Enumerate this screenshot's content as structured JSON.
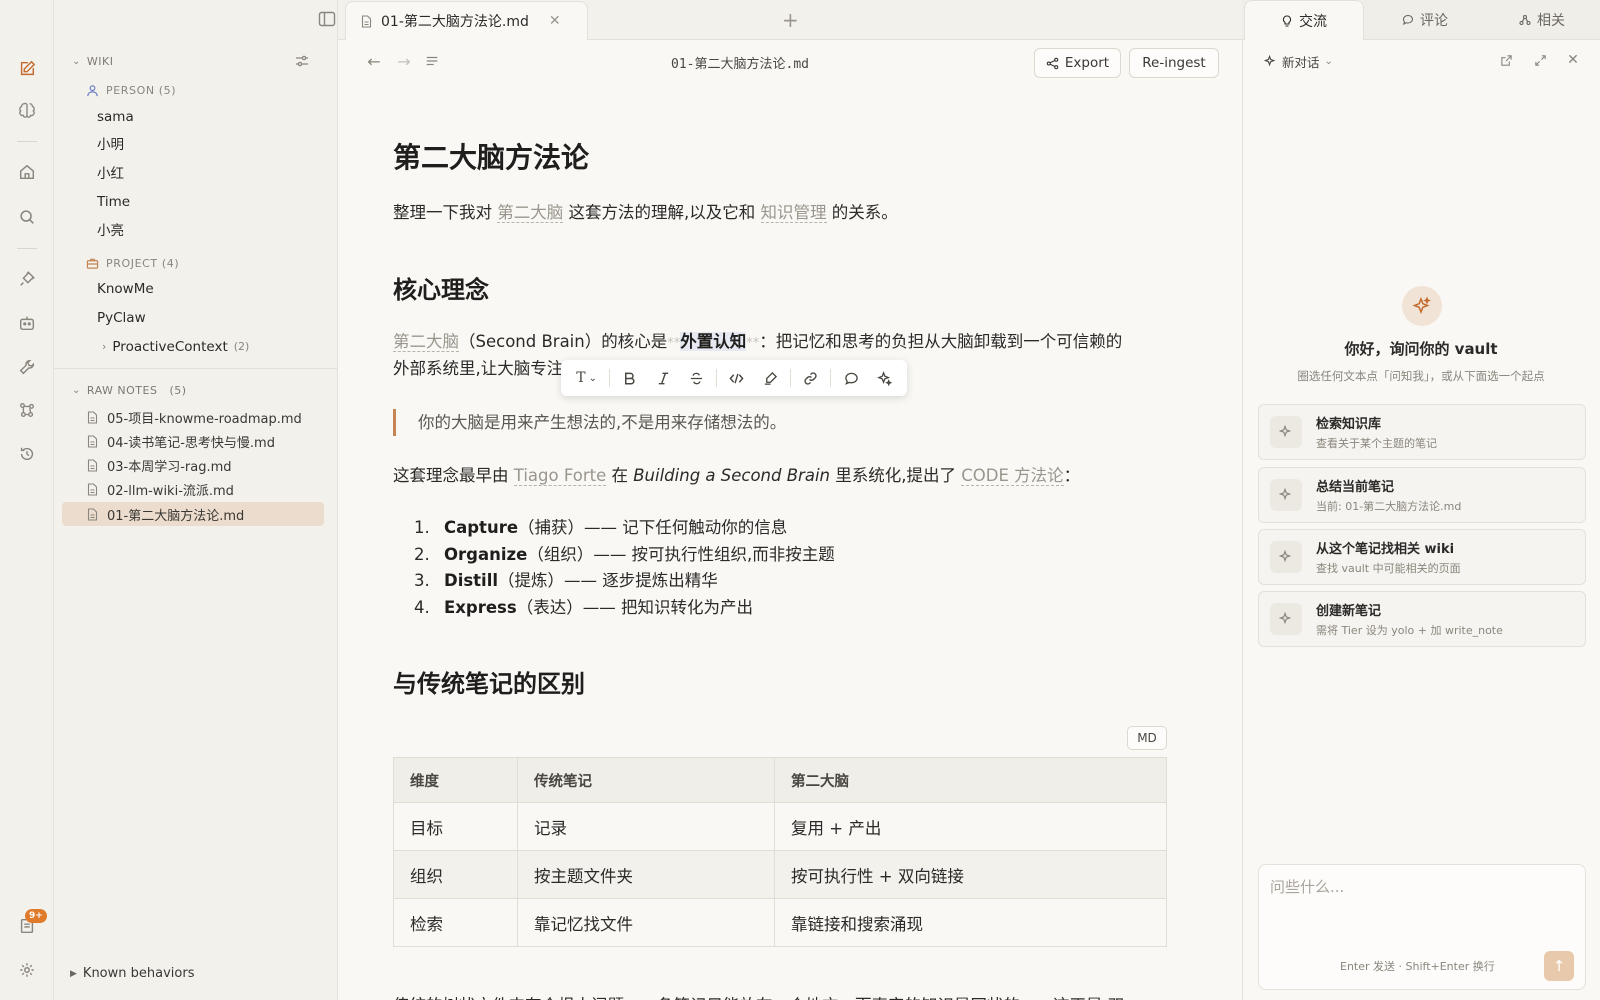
{
  "tab": {
    "title": "01-第二大脑方法论.md"
  },
  "toolbar": {
    "doc_title": "01-第二大脑方法论.md",
    "export_label": "Export",
    "reingest_label": "Re-ingest"
  },
  "sidebar": {
    "wiki_label": "WIKI",
    "person": {
      "label": "PERSON (5)",
      "items": [
        "sama",
        "小明",
        "小红",
        "Time",
        "小亮"
      ]
    },
    "project": {
      "label": "PROJECT (4)",
      "items": [
        "KnowMe",
        "PyClaw"
      ],
      "sub": {
        "label": "ProactiveContext",
        "count": "(2)"
      }
    },
    "raw": {
      "label": "RAW NOTES",
      "count": "(5)",
      "items": [
        "05-项目-knowme-roadmap.md",
        "04-读书笔记-思考快与慢.md",
        "03-本周学习-rag.md",
        "02-llm-wiki-流派.md",
        "01-第二大脑方法论.md"
      ]
    },
    "known_behaviors": "Known behaviors"
  },
  "rail": {
    "badge": "9+"
  },
  "doc": {
    "h1": "第二大脑方法论",
    "intro": {
      "p1": "整理一下我对",
      "l1": "第二大脑",
      "p2": "这套方法的理解,以及它和",
      "l2": "知识管理",
      "p3": "的关系。"
    },
    "h2_core": "核心理念",
    "core": {
      "link": "第二大脑",
      "a": "（Second Brain）的核心是",
      "mk": "**",
      "bold": "外置认知",
      "b": "：把记忆和思考的负担从大脑卸载到一个可信赖的",
      "line2": "外部系统里,让大脑专注"
    },
    "quote": "你的大脑是用来产生想法的,不是用来存储想法的。",
    "origin": {
      "a": "这套理念最早由",
      "link1": "Tiago Forte",
      "b": "在",
      "book": "Building a Second Brain",
      "c": "里系统化,提出了",
      "link2": "CODE 方法论",
      "d": "："
    },
    "code_list": [
      {
        "n": "1.",
        "term": "Capture",
        "desc": "（捕获）—— 记下任何触动你的信息"
      },
      {
        "n": "2.",
        "term": "Organize",
        "desc": "（组织）—— 按可执行性组织,而非按主题"
      },
      {
        "n": "3.",
        "term": "Distill",
        "desc": "（提炼）—— 逐步提炼出精华"
      },
      {
        "n": "4.",
        "term": "Express",
        "desc": "（表达）—— 把知识转化为产出"
      }
    ],
    "h2_diff": "与传统笔记的区别",
    "md_badge": "MD",
    "table": {
      "headers": [
        "维度",
        "传统笔记",
        "第二大脑"
      ],
      "rows": [
        [
          "目标",
          "记录",
          "复用 + 产出"
        ],
        [
          "组织",
          "按主题文件夹",
          "按可执行性 + 双向链接"
        ],
        [
          "检索",
          "靠记忆找文件",
          "靠链接和搜索涌现"
        ]
      ]
    },
    "cut_line": "传统的树状文件夹有个根本问题：一条笔记只能放在一个地方。而真实的知识是网状的——这正是 双"
  },
  "format_toolbar": {
    "text_label": "T"
  },
  "right_panel": {
    "tabs": [
      "交流",
      "评论",
      "相关"
    ],
    "new_conv": "新对话",
    "greeting": "你好，询问你的 vault",
    "greeting_sub": "圈选任何文本点「问知我」，或从下面选一个起点",
    "suggestions": [
      {
        "title": "检索知识库",
        "sub": "查看关于某个主题的笔记"
      },
      {
        "title": "总结当前笔记",
        "sub": "当前: 01-第二大脑方法论.md"
      },
      {
        "title": "从这个笔记找相关 wiki",
        "sub": "查找 vault 中可能相关的页面"
      },
      {
        "title": "创建新笔记",
        "sub": "需将 Tier 设为 yolo + 加 write_note"
      }
    ],
    "chat_placeholder": "问些什么...",
    "chat_hint": "Enter 发送 · Shift+Enter 换行"
  },
  "colors": {
    "accent": "#c46a2c",
    "active_row": "#ecdccd",
    "quote_bar": "#c48552"
  }
}
